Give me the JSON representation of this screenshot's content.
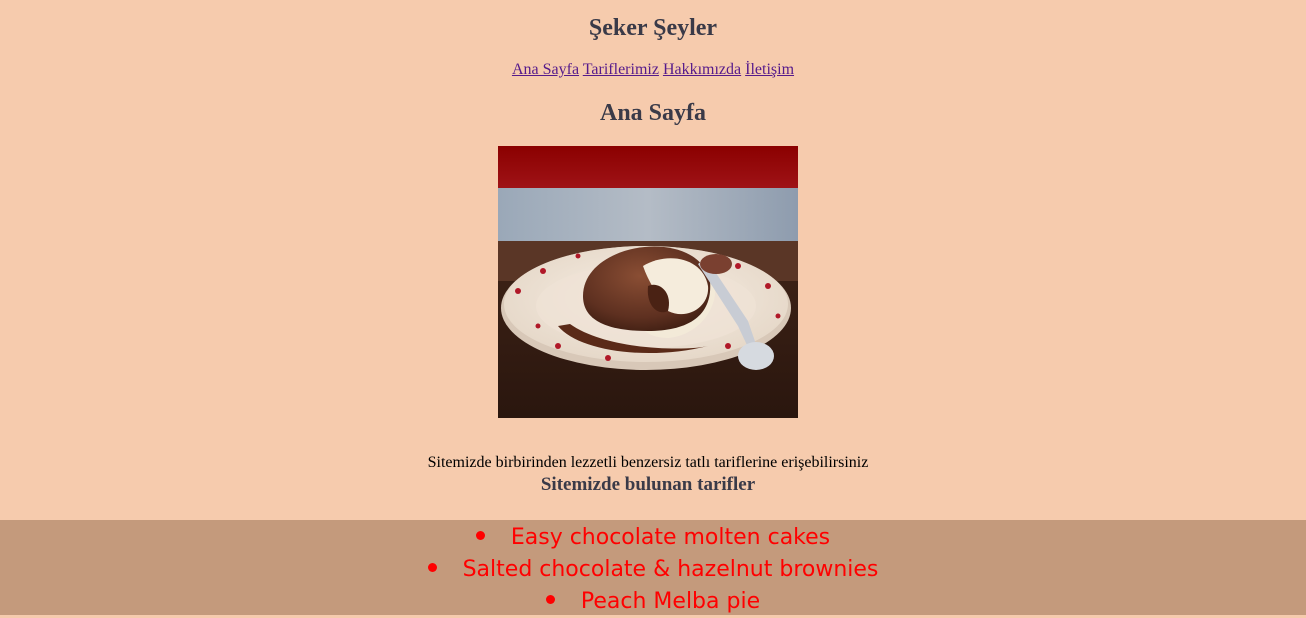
{
  "site": {
    "title": "Şeker Şeyler"
  },
  "nav": {
    "items": [
      {
        "label": "Ana Sayfa"
      },
      {
        "label": "Tariflerimiz"
      },
      {
        "label": "Hakkımızda"
      },
      {
        "label": "İletişim"
      }
    ]
  },
  "page": {
    "heading": "Ana Sayfa",
    "intro": "Sitemizde birbirinden lezzetli benzersiz tatlı tariflerine erişebilirsiniz",
    "recipes_heading": "Sitemizde bulunan tarifler"
  },
  "recipes": [
    {
      "name": "Easy chocolate molten cakes"
    },
    {
      "name": "Salted chocolate & hazelnut brownies"
    },
    {
      "name": "Peach Melba pie"
    }
  ],
  "colors": {
    "background": "#f6cbad",
    "recipe_band": "#c49a7c",
    "recipe_text": "#ff0000",
    "link": "#551a8b"
  }
}
